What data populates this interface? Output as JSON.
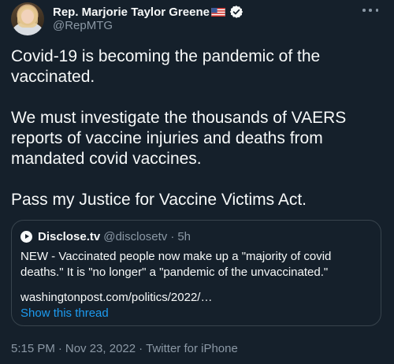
{
  "tweet": {
    "author": {
      "display_name": "Rep. Marjorie Taylor Greene",
      "handle": "@RepMTG",
      "flag_icon": "us-flag-icon",
      "verified_icon": "verified-badge-icon"
    },
    "more_icon": "more-options-icon",
    "paragraphs": [
      "Covid-19 is becoming the pandemic of the vaccinated.",
      "We must investigate the thousands of VAERS reports of vaccine injuries and deaths from mandated covid vaccines.",
      "Pass my Justice for Vaccine Victims Act."
    ],
    "quote": {
      "name": "Disclose.tv",
      "handle": "@disclosetv",
      "separator": "·",
      "time": "5h",
      "text": "NEW - Vaccinated people now make up a \"majority of covid deaths.\" It is \"no longer\" a \"pandemic of the unvaccinated.\"",
      "link": "washingtonpost.com/politics/2022/…",
      "show_thread": "Show this thread"
    },
    "meta": {
      "time": "5:15 PM",
      "sep1": "·",
      "date": "Nov 23, 2022",
      "sep2": "·",
      "client": "Twitter for iPhone"
    }
  },
  "colors": {
    "background": "#15202b",
    "text": "#f7f9f9",
    "secondary": "#8b98a5",
    "accent": "#1d9bf0",
    "border": "#38444d"
  }
}
